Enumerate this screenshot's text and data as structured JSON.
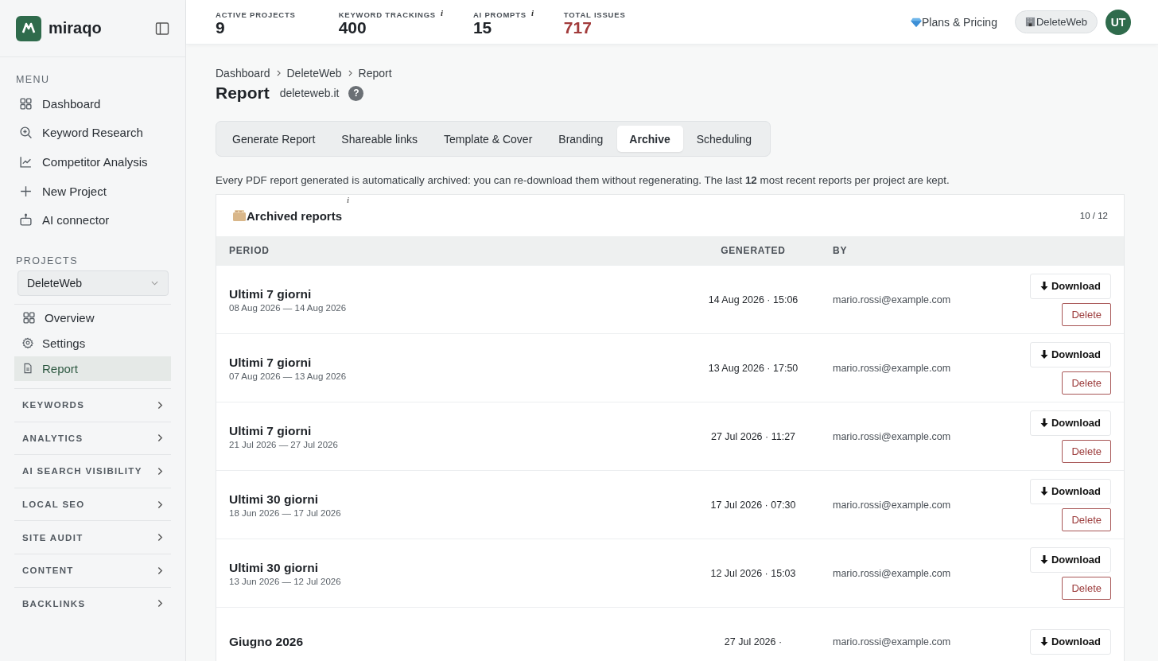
{
  "brand": {
    "name": "miraqo"
  },
  "sidebar": {
    "menu_title": "MENU",
    "menu": [
      {
        "label": "Dashboard"
      },
      {
        "label": "Keyword Research"
      },
      {
        "label": "Competitor Analysis"
      },
      {
        "label": "New Project"
      },
      {
        "label": "AI connector"
      }
    ],
    "projects_title": "PROJECTS",
    "project_select": {
      "value": "DeleteWeb"
    },
    "project_items": [
      {
        "label": "Overview",
        "selected": false
      },
      {
        "label": "Settings",
        "selected": false
      },
      {
        "label": "Report",
        "selected": true
      }
    ],
    "groups": [
      {
        "label": "KEYWORDS",
        "expanded": false
      },
      {
        "label": "ANALYTICS",
        "expanded": false
      },
      {
        "label": "AI SEARCH VISIBILITY",
        "expanded": false
      },
      {
        "label": "LOCAL SEO",
        "expanded": false
      },
      {
        "label": "SITE AUDIT",
        "expanded": false
      },
      {
        "label": "CONTENT",
        "expanded": false
      },
      {
        "label": "BACKLINKS",
        "expanded": false
      }
    ]
  },
  "stats": [
    {
      "label": "ACTIVE PROJECTS",
      "value": "9",
      "color": "#1f2328"
    },
    {
      "label": "KEYWORD TRACKINGS",
      "value": "400",
      "info": "i",
      "color": "#1f2328"
    },
    {
      "label": "AI PROMPTS",
      "value": "15",
      "info": "i",
      "color": "#1f2328"
    },
    {
      "label": "TOTAL ISSUES",
      "value": "717",
      "color": "#a23b3b"
    }
  ],
  "header_actions": {
    "pricing": "Plans & Pricing",
    "workspace": "DeleteWeb",
    "avatar": "UT"
  },
  "breadcrumb": [
    "Dashboard",
    "DeleteWeb",
    "Report"
  ],
  "page": {
    "title": "Report",
    "domain": "deleteweb.it",
    "help": "?"
  },
  "tabs": [
    {
      "label": "Generate Report",
      "selected": false
    },
    {
      "label": "Shareable links",
      "selected": false
    },
    {
      "label": "Template & Cover",
      "selected": false
    },
    {
      "label": "Branding",
      "selected": false
    },
    {
      "label": "Archive",
      "selected": true
    },
    {
      "label": "Scheduling",
      "selected": false
    }
  ],
  "description": "Every PDF report generated is automatically archived: you can re-download them without regenerating. The last **12** most recent reports per project are kept.",
  "archive": {
    "title": "Archived reports",
    "info": "i",
    "count": "10 / 12",
    "columns": [
      "PERIOD",
      "GENERATED",
      "BY"
    ],
    "rows": [
      {
        "period": "Ultimi 7 giorni",
        "range": "08 Aug 2026 — 14 Aug 2026",
        "generated": "14 Aug 2026 · 15:06",
        "by": "mario.rossi@example.com",
        "download": "Download",
        "delete": "Delete"
      },
      {
        "period": "Ultimi 7 giorni",
        "range": "07 Aug 2026 — 13 Aug 2026",
        "generated": "13 Aug 2026 · 17:50",
        "by": "mario.rossi@example.com",
        "download": "Download",
        "delete": "Delete"
      },
      {
        "period": "Ultimi 7 giorni",
        "range": "21 Jul 2026 — 27 Jul 2026",
        "generated": "27 Jul 2026 · 11:27",
        "by": "mario.rossi@example.com",
        "download": "Download",
        "delete": "Delete"
      },
      {
        "period": "Ultimi 30 giorni",
        "range": "18 Jun 2026 — 17 Jul 2026",
        "generated": "17 Jul 2026 · 07:30",
        "by": "mario.rossi@example.com",
        "download": "Download",
        "delete": "Delete"
      },
      {
        "period": "Ultimi 30 giorni",
        "range": "13 Jun 2026 — 12 Jul 2026",
        "generated": "12 Jul 2026 · 15:03",
        "by": "mario.rossi@example.com",
        "download": "Download",
        "delete": "Delete"
      },
      {
        "period": "Giugno 2026",
        "generated": "27 Jul 2026 ·",
        "by": "mario.rossi@example.com",
        "download": "Download"
      }
    ]
  }
}
